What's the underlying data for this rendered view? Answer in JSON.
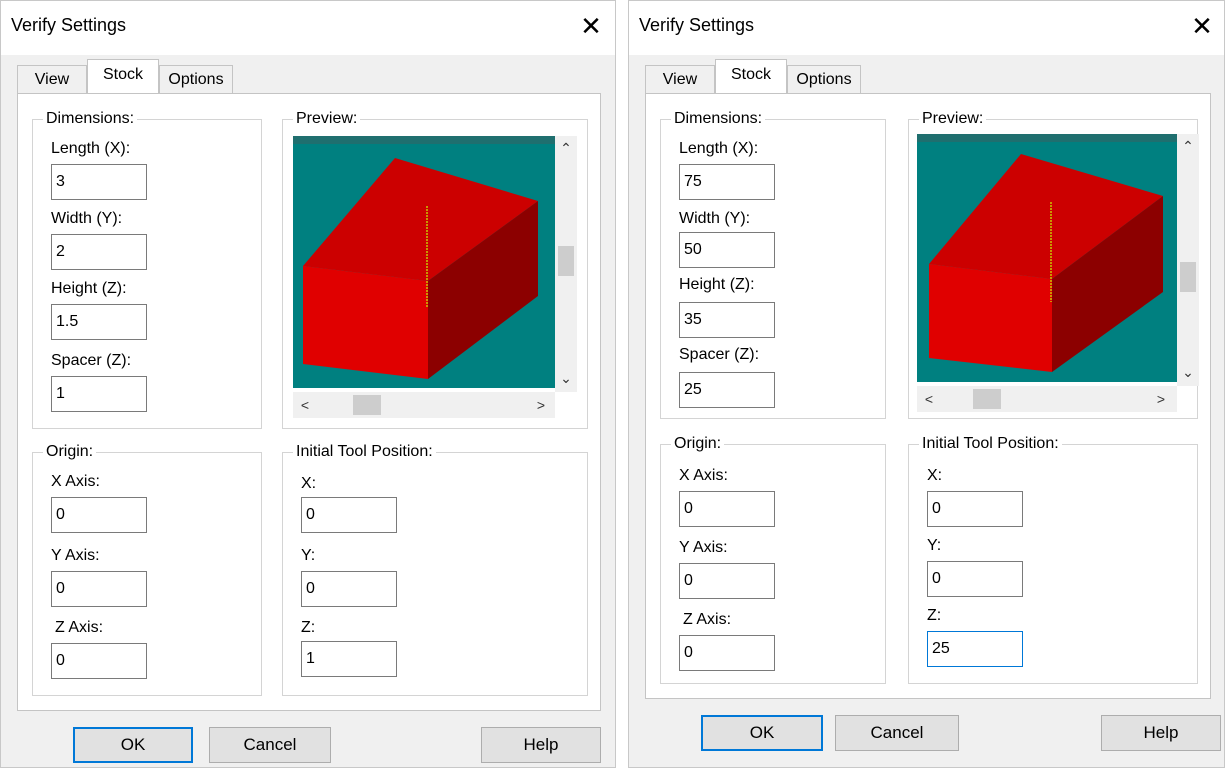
{
  "dialogs": [
    {
      "title": "Verify Settings",
      "close_glyph": "✕",
      "tabs": [
        "View",
        "Stock",
        "Options"
      ],
      "active_tab": "Stock",
      "dimensions": {
        "legend": "Dimensions:",
        "length_label": "Length (X):",
        "length_value": "3",
        "width_label": "Width (Y):",
        "width_value": "2",
        "height_label": "Height (Z):",
        "height_value": "1.5",
        "spacer_label": "Spacer (Z):",
        "spacer_value": "1"
      },
      "preview": {
        "legend": "Preview:"
      },
      "origin": {
        "legend": "Origin:",
        "x_label": "X Axis:",
        "x_value": "0",
        "y_label": "Y Axis:",
        "y_value": "0",
        "z_label": "Z Axis:",
        "z_value": "0"
      },
      "tool_position": {
        "legend": "Initial Tool Position:",
        "x_label": "X:",
        "x_value": "0",
        "y_label": "Y:",
        "y_value": "0",
        "z_label": "Z:",
        "z_value": "1"
      },
      "buttons": {
        "ok": "OK",
        "cancel": "Cancel",
        "help": "Help"
      }
    },
    {
      "title": "Verify Settings",
      "close_glyph": "✕",
      "tabs": [
        "View",
        "Stock",
        "Options"
      ],
      "active_tab": "Stock",
      "dimensions": {
        "legend": "Dimensions:",
        "length_label": "Length (X):",
        "length_value": "75",
        "width_label": "Width (Y):",
        "width_value": "50",
        "height_label": "Height (Z):",
        "height_value": "35",
        "spacer_label": "Spacer (Z):",
        "spacer_value": "25"
      },
      "preview": {
        "legend": "Preview:"
      },
      "origin": {
        "legend": "Origin:",
        "x_label": "X Axis:",
        "x_value": "0",
        "y_label": "Y Axis:",
        "y_value": "0",
        "z_label": "Z Axis:",
        "z_value": "0"
      },
      "tool_position": {
        "legend": "Initial Tool Position:",
        "x_label": "X:",
        "x_value": "0",
        "y_label": "Y:",
        "y_value": "0",
        "z_label": "Z:",
        "z_value": "25"
      },
      "buttons": {
        "ok": "OK",
        "cancel": "Cancel",
        "help": "Help"
      }
    }
  ],
  "colors": {
    "preview_background": "#008080",
    "stock_top": "#cc0000",
    "stock_front": "#e00000",
    "stock_side": "#8c0000",
    "tool_line": "#c8c800",
    "focus_border": "#0078d7"
  },
  "icons": {
    "scroll_up": "chevron-up-icon",
    "scroll_down": "chevron-down-icon",
    "scroll_left": "chevron-left-icon",
    "scroll_right": "chevron-right-icon",
    "close": "close-icon"
  }
}
